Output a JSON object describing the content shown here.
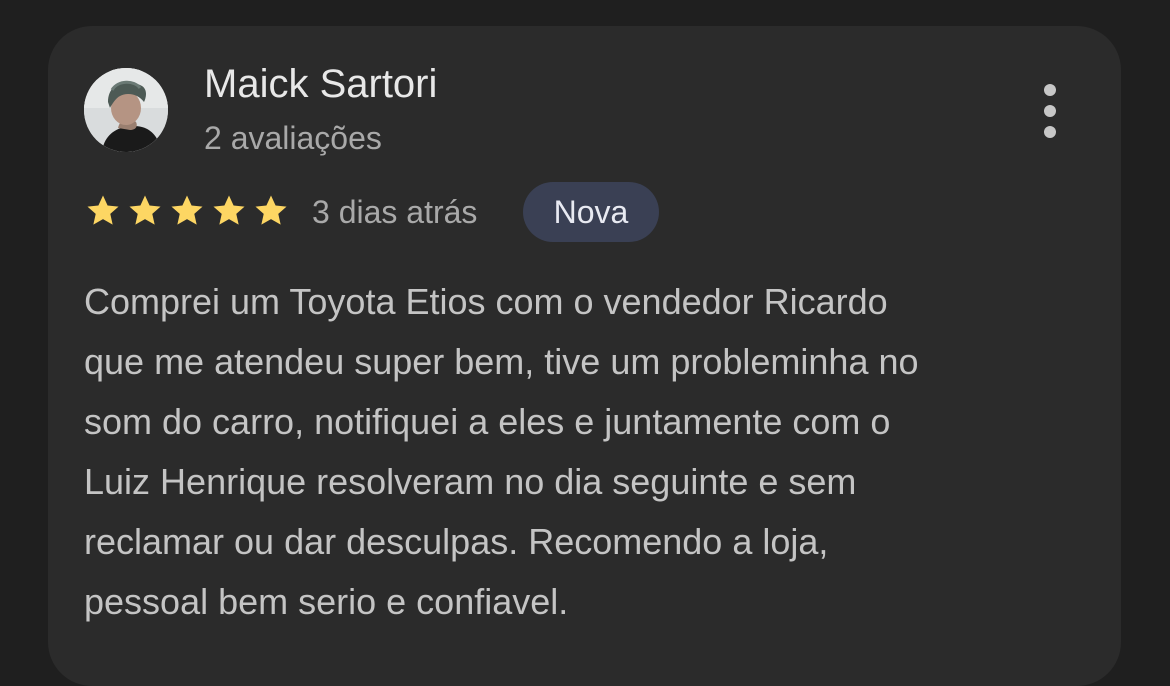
{
  "review": {
    "author": {
      "name": "Maick Sartori",
      "reviews_count": "2 avaliações",
      "avatar_icon": "user-avatar"
    },
    "menu_icon": "more-vert-icon",
    "rating": 5,
    "max_rating": 5,
    "star_color": "#fdd663",
    "date": "3 dias atrás",
    "badge": "Nova",
    "text_lines": [
      "Comprei um Toyota Etios com o vendedor Ricardo",
      "que me atendeu super bem, tive um probleminha no",
      "som do carro, notifiquei a eles e juntamente com o",
      "Luiz Henrique resolveram no dia seguinte e sem",
      "reclamar ou dar desculpas. Recomendo a loja,",
      "pessoal bem serio e confiavel."
    ]
  }
}
